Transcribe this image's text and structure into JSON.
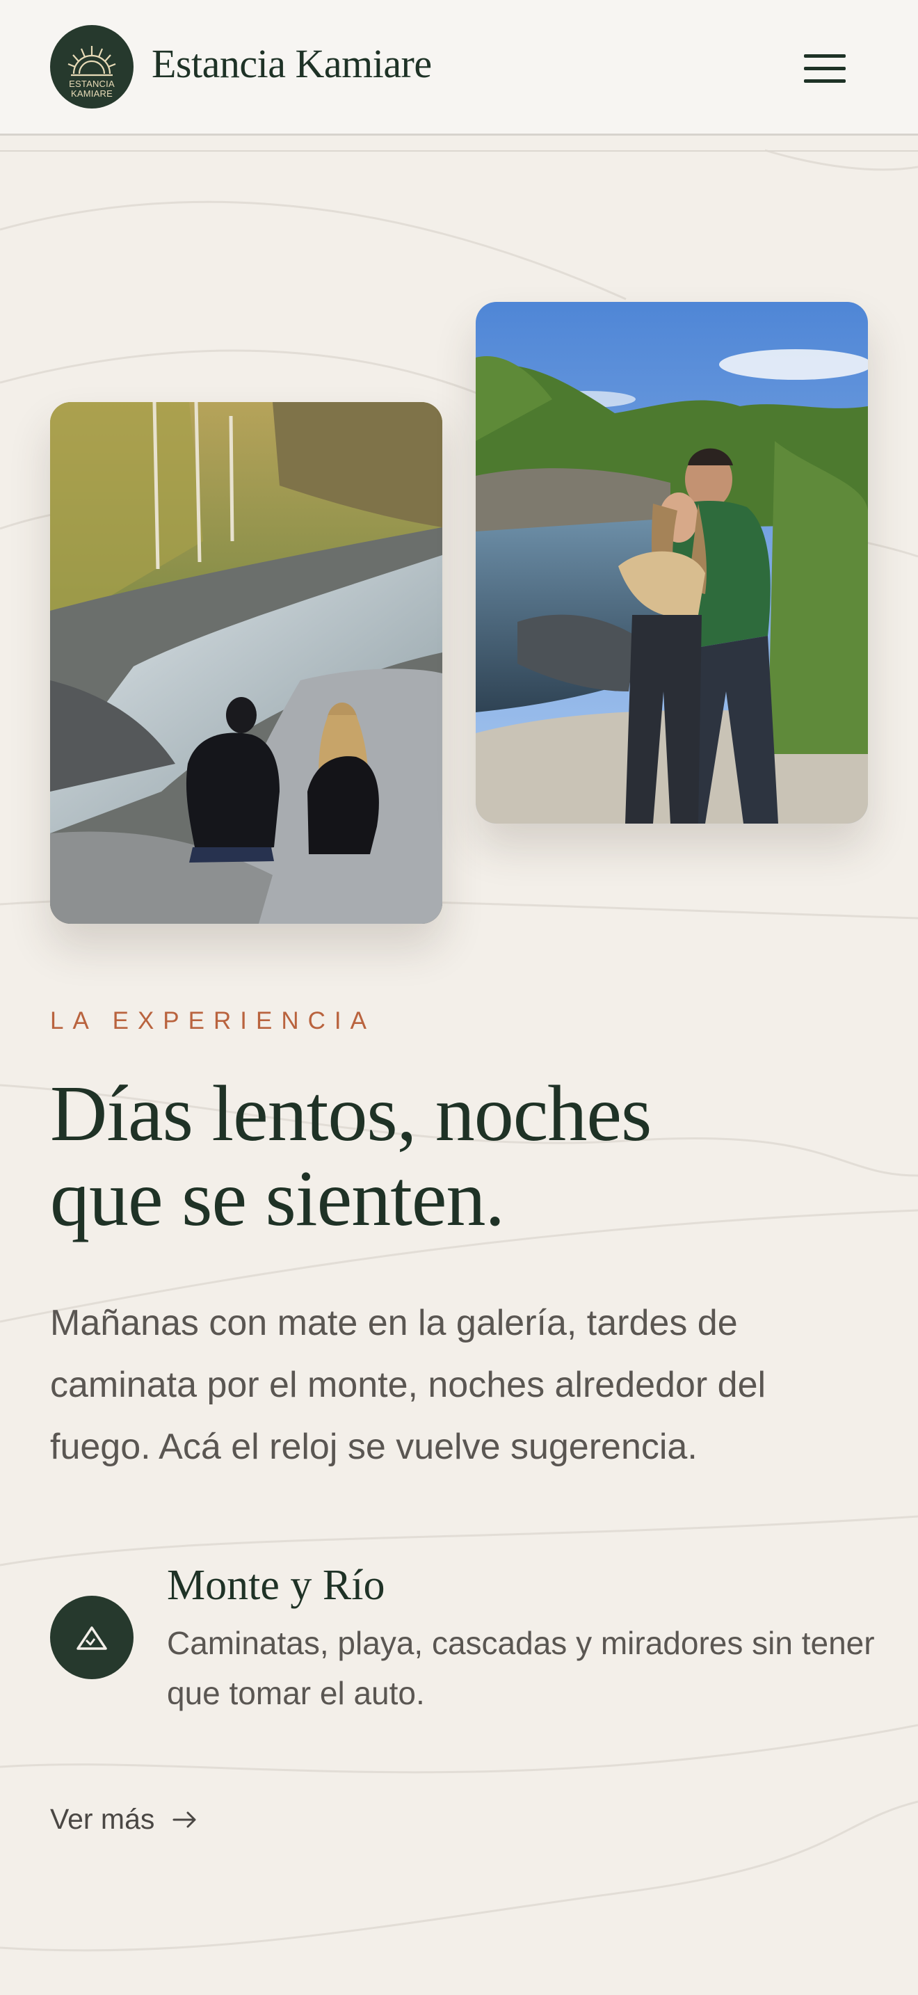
{
  "header": {
    "logo_text": [
      "ESTANCIA",
      "KAMIARE"
    ],
    "brand": "Estancia Kamiare",
    "menu_icon": "hamburger-menu-icon"
  },
  "photos": [
    {
      "name": "river-couple-sitting-photo",
      "description_icon": "photo"
    },
    {
      "name": "couple-portrait-photo",
      "description_icon": "photo"
    }
  ],
  "section": {
    "eyebrow": "LA EXPERIENCIA",
    "headline_line1": "Días lentos, noches",
    "headline_line2": "que se sienten.",
    "intro": "Mañanas con mate en la galería, tardes de caminata por el monte, noches alrededor del fuego. Acá el reloj se vuelve sugerencia."
  },
  "feature": {
    "icon": "mountain-icon",
    "title": "Monte y Río",
    "description": "Caminatas, playa, cascadas y miradores sin tener que tomar el auto."
  },
  "cta": {
    "label": "Ver más",
    "icon": "arrow-right-icon"
  },
  "colors": {
    "background": "#f3efe9",
    "primary": "#26392d",
    "accent": "#b9633e",
    "text": "#5a5652"
  }
}
